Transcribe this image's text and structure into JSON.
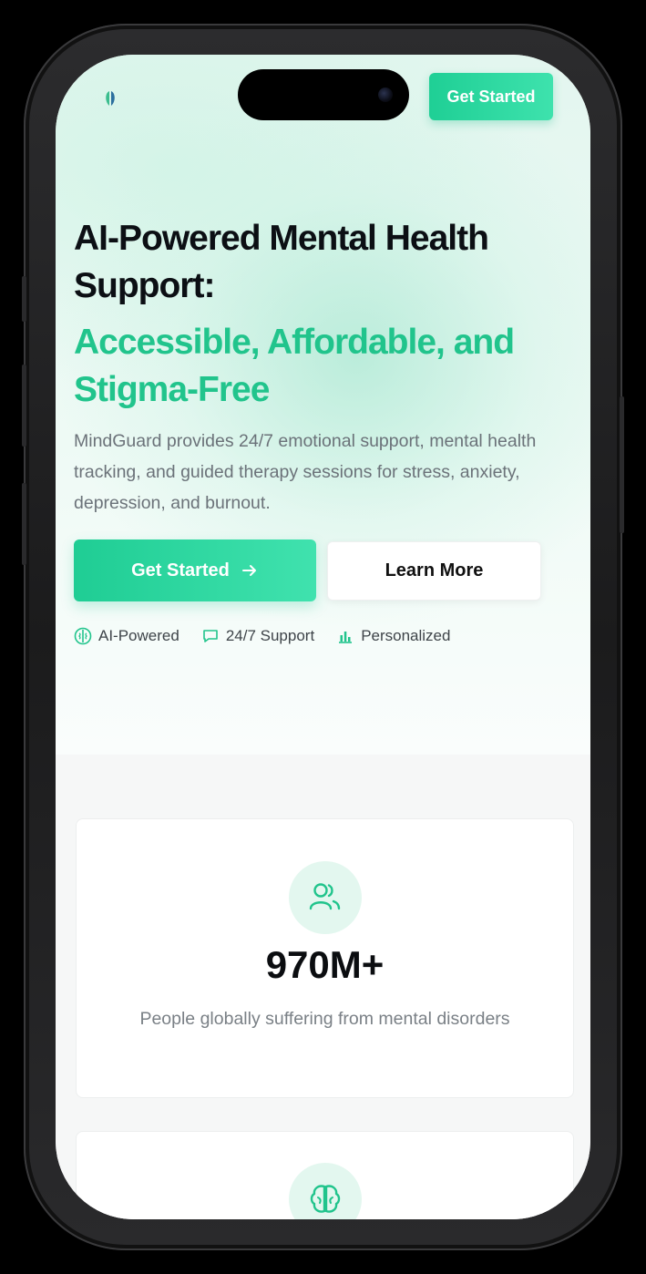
{
  "header": {
    "logo_icon": "brain-leaf-logo",
    "cta_label": "Get Started"
  },
  "hero": {
    "title": "AI-Powered Mental Health Support:",
    "subtitle": "Accessible, Affordable, and Stigma-Free",
    "description": "MindGuard provides 24/7 emotional support, mental health tracking, and guided therapy sessions for stress, anxiety, depression, and burnout.",
    "primary_cta": "Get Started",
    "primary_cta_icon": "arrow-right-icon",
    "secondary_cta": "Learn More",
    "features": [
      {
        "icon": "brain-icon",
        "label": "AI-Powered"
      },
      {
        "icon": "chat-bubble-icon",
        "label": "24/7 Support"
      },
      {
        "icon": "bar-chart-icon",
        "label": "Personalized"
      }
    ]
  },
  "stats": [
    {
      "icon": "users-icon",
      "value": "970M+",
      "label": "People globally suffering from mental disorders"
    },
    {
      "icon": "brain-icon",
      "value": "",
      "label": ""
    }
  ],
  "colors": {
    "accent": "#21c48c",
    "accent_light": "#e3f7ef",
    "text_dark": "#0c0f14",
    "text_muted": "#6b7279"
  }
}
